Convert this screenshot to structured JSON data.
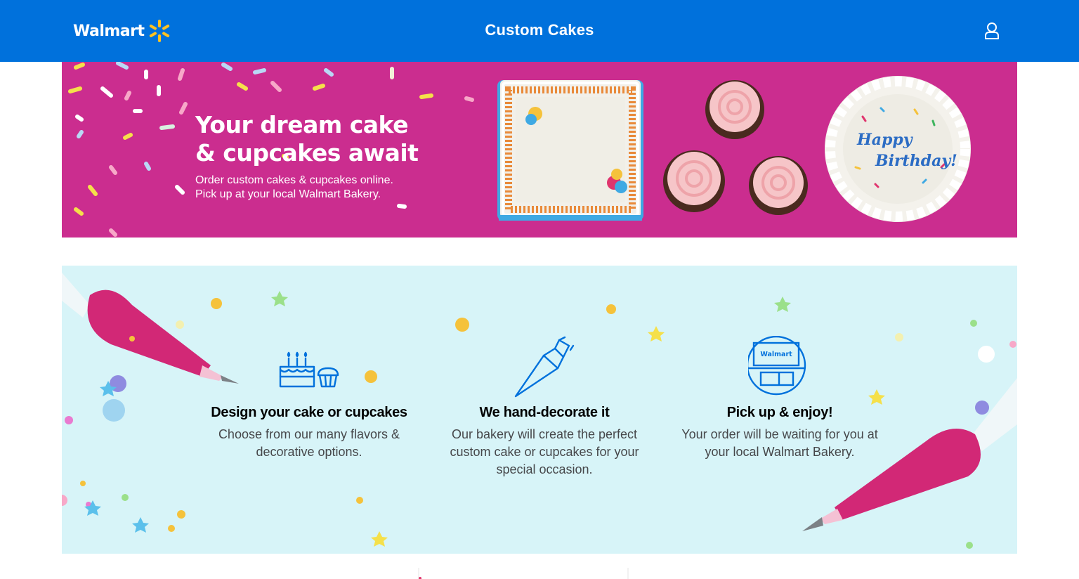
{
  "header": {
    "logo_text": "Walmart",
    "logo_icon": "spark-icon",
    "title": "Custom Cakes",
    "account_icon": "account-icon"
  },
  "hero": {
    "heading": "Your dream cake & cupcakes await",
    "subtext_line1": "Order custom cakes & cupcakes online.",
    "subtext_line2": "Pick up at your local Walmart Bakery.",
    "cake_message": "Happy Birthday!",
    "background_color": "#cb2d8f"
  },
  "steps": [
    {
      "icon": "cake-cupcake-icon",
      "title": "Design your cake or cupcakes",
      "description": "Choose from our many flavors & decorative options."
    },
    {
      "icon": "piping-bag-icon",
      "title": "We hand-decorate it",
      "description": "Our bakery will create the perfect custom cake or cupcakes for your special occasion."
    },
    {
      "icon": "walmart-store-icon",
      "title": "Pick up & enjoy!",
      "description": "Your order will be waiting for you at your local Walmart Bakery.",
      "store_sign": "Walmart"
    }
  ],
  "colors": {
    "brand_blue": "#0071dc",
    "spark_yellow": "#ffc220",
    "hero_pink": "#cb2d8f",
    "section_bg": "#d7f4f8"
  }
}
